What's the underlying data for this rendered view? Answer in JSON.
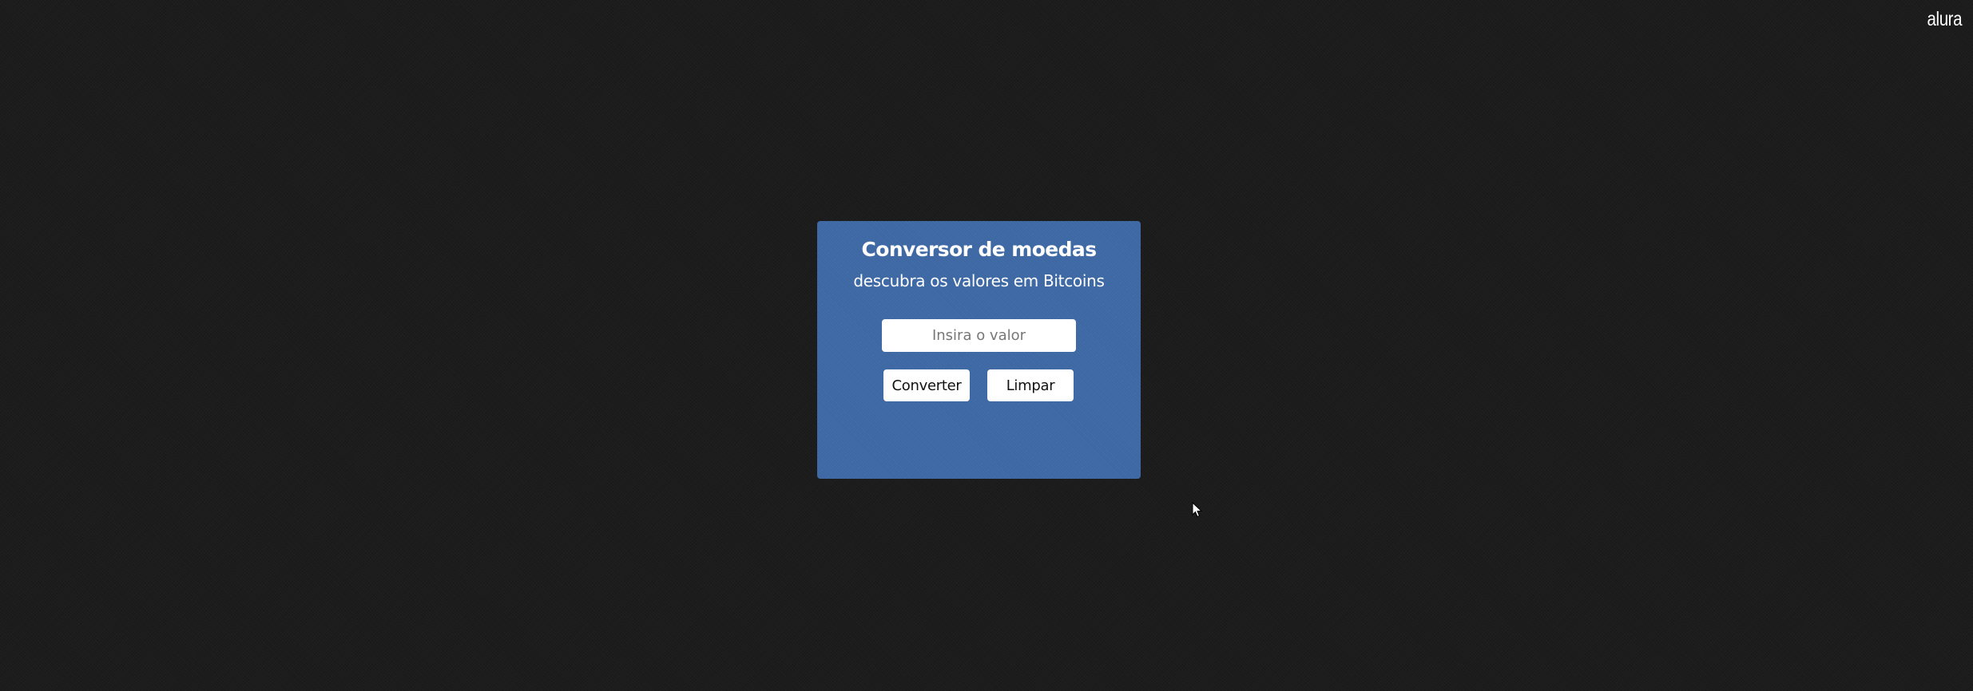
{
  "brand": {
    "logo_text": "alura"
  },
  "converter": {
    "title": "Conversor de moedas",
    "subtitle": "descubra os valores em Bitcoins",
    "input": {
      "placeholder": "Insira o valor",
      "value": ""
    },
    "buttons": {
      "convert_label": "Converter",
      "clear_label": "Limpar"
    }
  },
  "colors": {
    "background": "#1c1c1c",
    "card": "#3d68a4",
    "text_light": "#ffffff",
    "button_bg": "#ffffff"
  },
  "icons": {
    "cursor": "mouse-pointer-icon"
  }
}
